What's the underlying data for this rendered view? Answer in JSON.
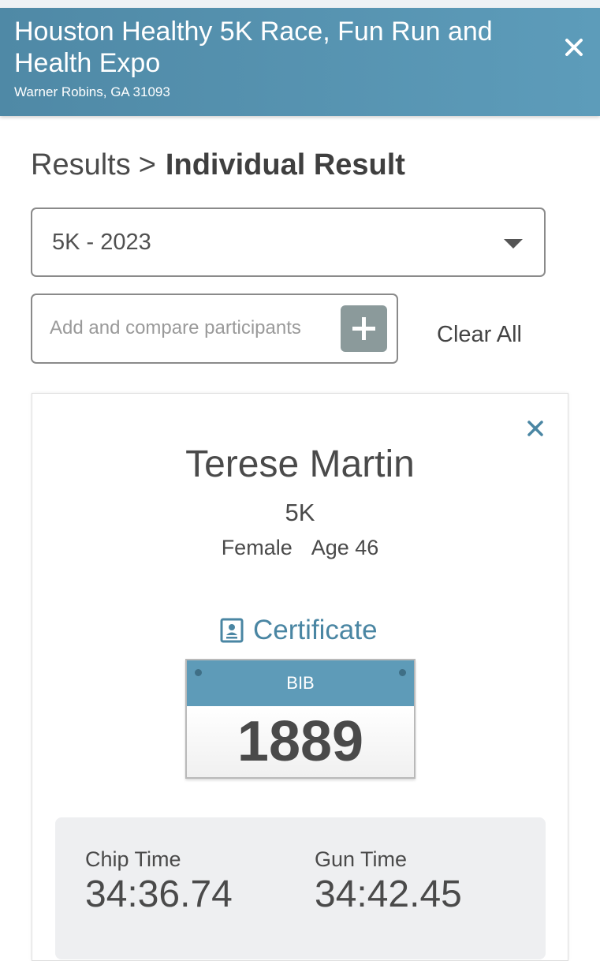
{
  "header": {
    "title": "Houston Healthy 5K Race, Fun Run and Health Expo",
    "location": "Warner Robins, GA 31093",
    "close_icon": "close-icon"
  },
  "breadcrumb": {
    "parent": "Results",
    "separator": ">",
    "current": "Individual Result"
  },
  "event_select": {
    "selected": "5K - 2023"
  },
  "compare": {
    "placeholder": "Add and compare participants",
    "value": "",
    "add_icon": "plus-icon",
    "clear_label": "Clear All"
  },
  "participant": {
    "name": "Terese Martin",
    "race": "5K",
    "gender": "Female",
    "age": "Age 46",
    "certificate_label": "Certificate",
    "certificate_icon": "certificate-icon",
    "bib_label": "BIB",
    "bib_number": "1889",
    "chip_time_label": "Chip Time",
    "chip_time": "34:36.74",
    "gun_time_label": "Gun Time",
    "gun_time": "34:42.45"
  },
  "colors": {
    "header_bg": "#5a94b2",
    "accent": "#4a86a3",
    "bib_top": "#5e9bb8",
    "add_button": "#8b9a9b"
  }
}
